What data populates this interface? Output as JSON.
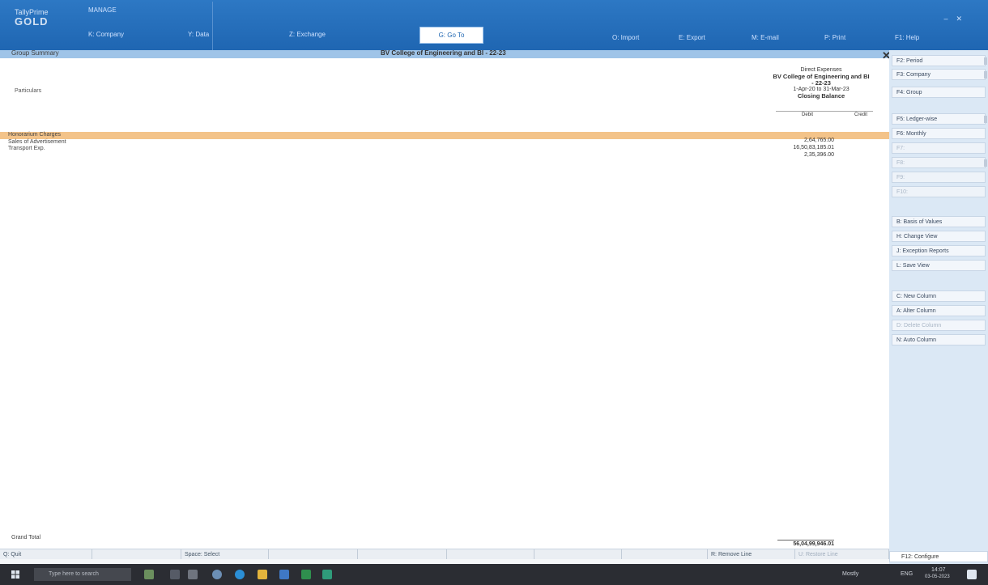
{
  "app": {
    "logo_top": "TallyPrime",
    "logo_name": "GOLD",
    "manage_label": "MANAGE",
    "company_label": "K: Company",
    "data_label": "Y: Data",
    "exchange_label": "Z: Exchange",
    "goto_label": "G: Go To",
    "import_label": "O: Import",
    "export_label": "E: Export",
    "email_label": "M: E-mail",
    "print_label": "P: Print",
    "help_label": "F1: Help"
  },
  "report": {
    "window_title": "Group Summary",
    "company_title": "BV College of Engineering and BI - 22-23",
    "subtitle": "Particulars",
    "head_line1": "Direct Expenses",
    "head_line2": "BV College of Engineering and BI",
    "head_line3": "- 22-23",
    "head_period": "1-Apr-20 to 31-Mar-23",
    "head_closing": "Closing Balance",
    "debit_label": "Debit",
    "credit_label": "Credit",
    "rows": [
      {
        "label": "Honorarium Charges",
        "value": "2,64,765.00",
        "highlight": true
      },
      {
        "label": "Sales of Advertisement",
        "value": "16,50,83,185.01",
        "highlight": false
      },
      {
        "label": "Transport Exp.",
        "value": "2,35,396.00",
        "highlight": false
      }
    ],
    "grand_total_label": "Grand Total",
    "grand_total_value": "56,04,99,946.01"
  },
  "bottom_bar": {
    "quit": "Q: Quit",
    "select": "Space: Select",
    "remove_line": "R: Remove Line",
    "restore_line": "U: Restore Line"
  },
  "right_panel": {
    "period": "F2: Period",
    "company": "F3: Company",
    "group": "F4: Group",
    "ledgerwise": "F5: Ledger-wise",
    "monthly": "F6: Monthly",
    "f7": "F7:",
    "f8": "F8:",
    "f9": "F9:",
    "f10": "F10:",
    "basis_of_values": "B: Basis of Values",
    "change_view": "H: Change View",
    "exception_reports": "J: Exception Reports",
    "save_view": "L: Save View",
    "new_column": "C: New Column",
    "alter_column": "A: Alter Column",
    "delete_column": "D: Delete Column",
    "auto_column": "N: Auto Column",
    "configure": "F12: Configure"
  },
  "taskbar": {
    "search_placeholder": "Type here to search",
    "weather": "Mostly",
    "language": "ENG",
    "time": "14:07",
    "date": "03-05-2023"
  }
}
